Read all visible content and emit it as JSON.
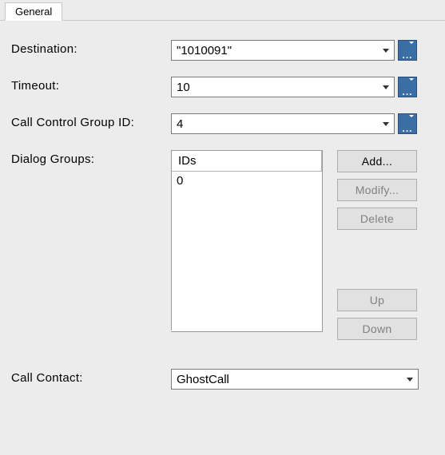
{
  "tab": {
    "label": "General"
  },
  "fields": {
    "destination": {
      "label": "Destination:",
      "value": "\"1010091\""
    },
    "timeout": {
      "label": "Timeout:",
      "value": "10"
    },
    "ccgid": {
      "label": "Call Control Group ID:",
      "value": "4"
    },
    "dialog": {
      "label": "Dialog Groups:",
      "header": "IDs",
      "items": [
        "0"
      ]
    },
    "contact": {
      "label": "Call Contact:",
      "value": "GhostCall"
    }
  },
  "buttons": {
    "add": "Add...",
    "modify": "Modify...",
    "delete": "Delete",
    "up": "Up",
    "down": "Down"
  }
}
